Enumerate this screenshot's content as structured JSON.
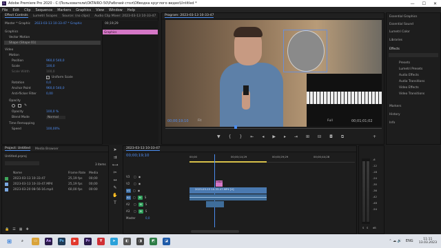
{
  "window": {
    "title": "Adobe Premiere Pro 2020 - C:\\Пользователи\\OKTAIRO-50\\Рабочий стол\\Обводка круглого видео\\Untitled *",
    "min": "—",
    "max": "☐",
    "close": "✕"
  },
  "menu": [
    "File",
    "Edit",
    "Clip",
    "Sequence",
    "Markers",
    "Graphics",
    "View",
    "Window",
    "Help"
  ],
  "top_tabs": {
    "effect_controls": "Effect Controls",
    "lumetri_scopes": "Lumetri Scopes",
    "source": "Source: (no clips)",
    "audio_mixer": "Audio Clip Mixer: 2023-03-13 10-33-47",
    "program": "Program: 2023-03-13 10-33-47"
  },
  "ec": {
    "master": "Master * Graphic",
    "clip": "2023-03-13 10-33-47 * Graphic",
    "timecode": "00;19;29",
    "graphics_bar": "Graphics",
    "section_graphics": "Graphics",
    "vector_motion": "Vector Motion",
    "shape": "Shape (Shape 01)",
    "section_video": "Video",
    "motion": "Motion",
    "position_label": "Position",
    "position_x": "960,0",
    "position_y": "540,0",
    "scale_label": "Scale",
    "scale_value": "100,0",
    "scale_width_label": "Scale Width",
    "uniform_scale": "Uniform Scale",
    "rotation_label": "Rotation",
    "rotation_value": "0,0",
    "anchor_label": "Anchor Point",
    "anchor_x": "960,0",
    "anchor_y": "540,0",
    "flicker_label": "Anti-flicker Filter",
    "flicker_value": "0,00",
    "opacity_section": "Opacity",
    "opacity_label": "Opacity",
    "opacity_value": "100,0 %",
    "blend_label": "Blend Mode",
    "blend_value": "Normal",
    "time_remap": "Time Remapping",
    "speed_label": "Speed",
    "speed_value": "100,00%"
  },
  "program": {
    "timecode": "00;00;19;10",
    "fit": "Fit",
    "quality": "Full",
    "duration": "00;01;01;02"
  },
  "project": {
    "tabs": [
      "Project: Untitled",
      "Media Browser"
    ],
    "file": "Untitled.prproj",
    "count": "3 items",
    "columns": [
      "Name",
      "Frame Rate",
      "Media"
    ],
    "rows": [
      {
        "name": "2023-03-13 10-33-47",
        "rate": "25,19 fps",
        "media": "00;00"
      },
      {
        "name": "2023-03-13 10-33-47.MP4",
        "rate": "25,19 fps",
        "media": "00;00"
      },
      {
        "name": "2023-03-20 08-56-16.mp4",
        "rate": "60,00 fps",
        "media": "00:00"
      }
    ]
  },
  "timeline": {
    "tab": "2023-03-13 10-33-47",
    "timecode": "00;00;19;10",
    "ruler": [
      "00;00",
      "00;00;14;29",
      "00;00;29;29",
      "00;00;44;28"
    ],
    "tracks": [
      "V3",
      "V2",
      "V1",
      "A1",
      "A2",
      "A3",
      "Master"
    ],
    "master_value": "0,0",
    "v2_clip": "Graphic",
    "v1_clip": "2023-03-13 10-33-47.MP4 [V]"
  },
  "meter": {
    "scale": [
      "-6",
      "-12",
      "-18",
      "-24",
      "-30",
      "-36",
      "-42",
      "-48",
      "-54"
    ],
    "unit": "dB",
    "s": "S",
    "s2": "S"
  },
  "right_panel": {
    "items": [
      "Essential Graphics",
      "Essential Sound",
      "Lumetri Color",
      "Libraries"
    ],
    "effects_title": "Effects",
    "effects": [
      "Presets",
      "Lumetri Presets",
      "Audio Effects",
      "Audio Transitions",
      "Video Effects",
      "Video Transitions"
    ],
    "bottom": [
      "Markers",
      "History",
      "Info"
    ]
  },
  "taskbar": {
    "lang": "ENG",
    "time": "11:11",
    "date": "13.03.2023"
  },
  "colors": {
    "accent": "#4a8cf0",
    "graphic_clip": "#d577c6",
    "video_clip": "#4a79b0",
    "audio_clip": "#3f6d9a",
    "track_v": "#3b6fa8",
    "track_a": "#2e9e5a"
  }
}
